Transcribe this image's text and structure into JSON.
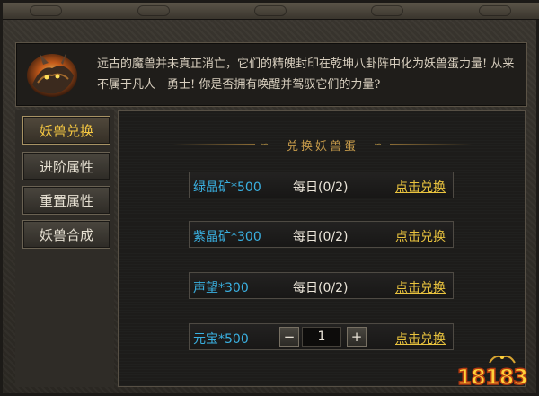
{
  "header": {
    "intro_text": "远古的魔兽并未真正消亡，它们的精魄封印在乾坤八卦阵中化为妖兽蛋力量! 从来不属于凡人　勇士! 你是否拥有唤醒并驾驭它们的力量?",
    "portrait_icon": "demon-beast-portrait"
  },
  "sidebar": {
    "tabs": [
      {
        "label": "妖兽兑换",
        "active": true
      },
      {
        "label": "进阶属性",
        "active": false
      },
      {
        "label": "重置属性",
        "active": false
      },
      {
        "label": "妖兽合成",
        "active": false
      }
    ]
  },
  "main": {
    "section_title": "兑换妖兽蛋",
    "rows": [
      {
        "item": "绿晶矿*500",
        "daily": "每日(0/2)",
        "action": "点击兑换"
      },
      {
        "item": "紫晶矿*300",
        "daily": "每日(0/2)",
        "action": "点击兑换"
      },
      {
        "item": "声望*300",
        "daily": "每日(0/2)",
        "action": "点击兑换"
      },
      {
        "item": "元宝*500",
        "stepper": {
          "minus": "−",
          "value": "1",
          "plus": "+"
        },
        "action": "点击兑换"
      }
    ]
  },
  "watermark": {
    "text": "18183"
  },
  "colors": {
    "item_blue": "#3ab1e2",
    "action_gold": "#e9c33e",
    "active_tab_gold": "#f6c842",
    "title_gold": "#c59a4a"
  }
}
